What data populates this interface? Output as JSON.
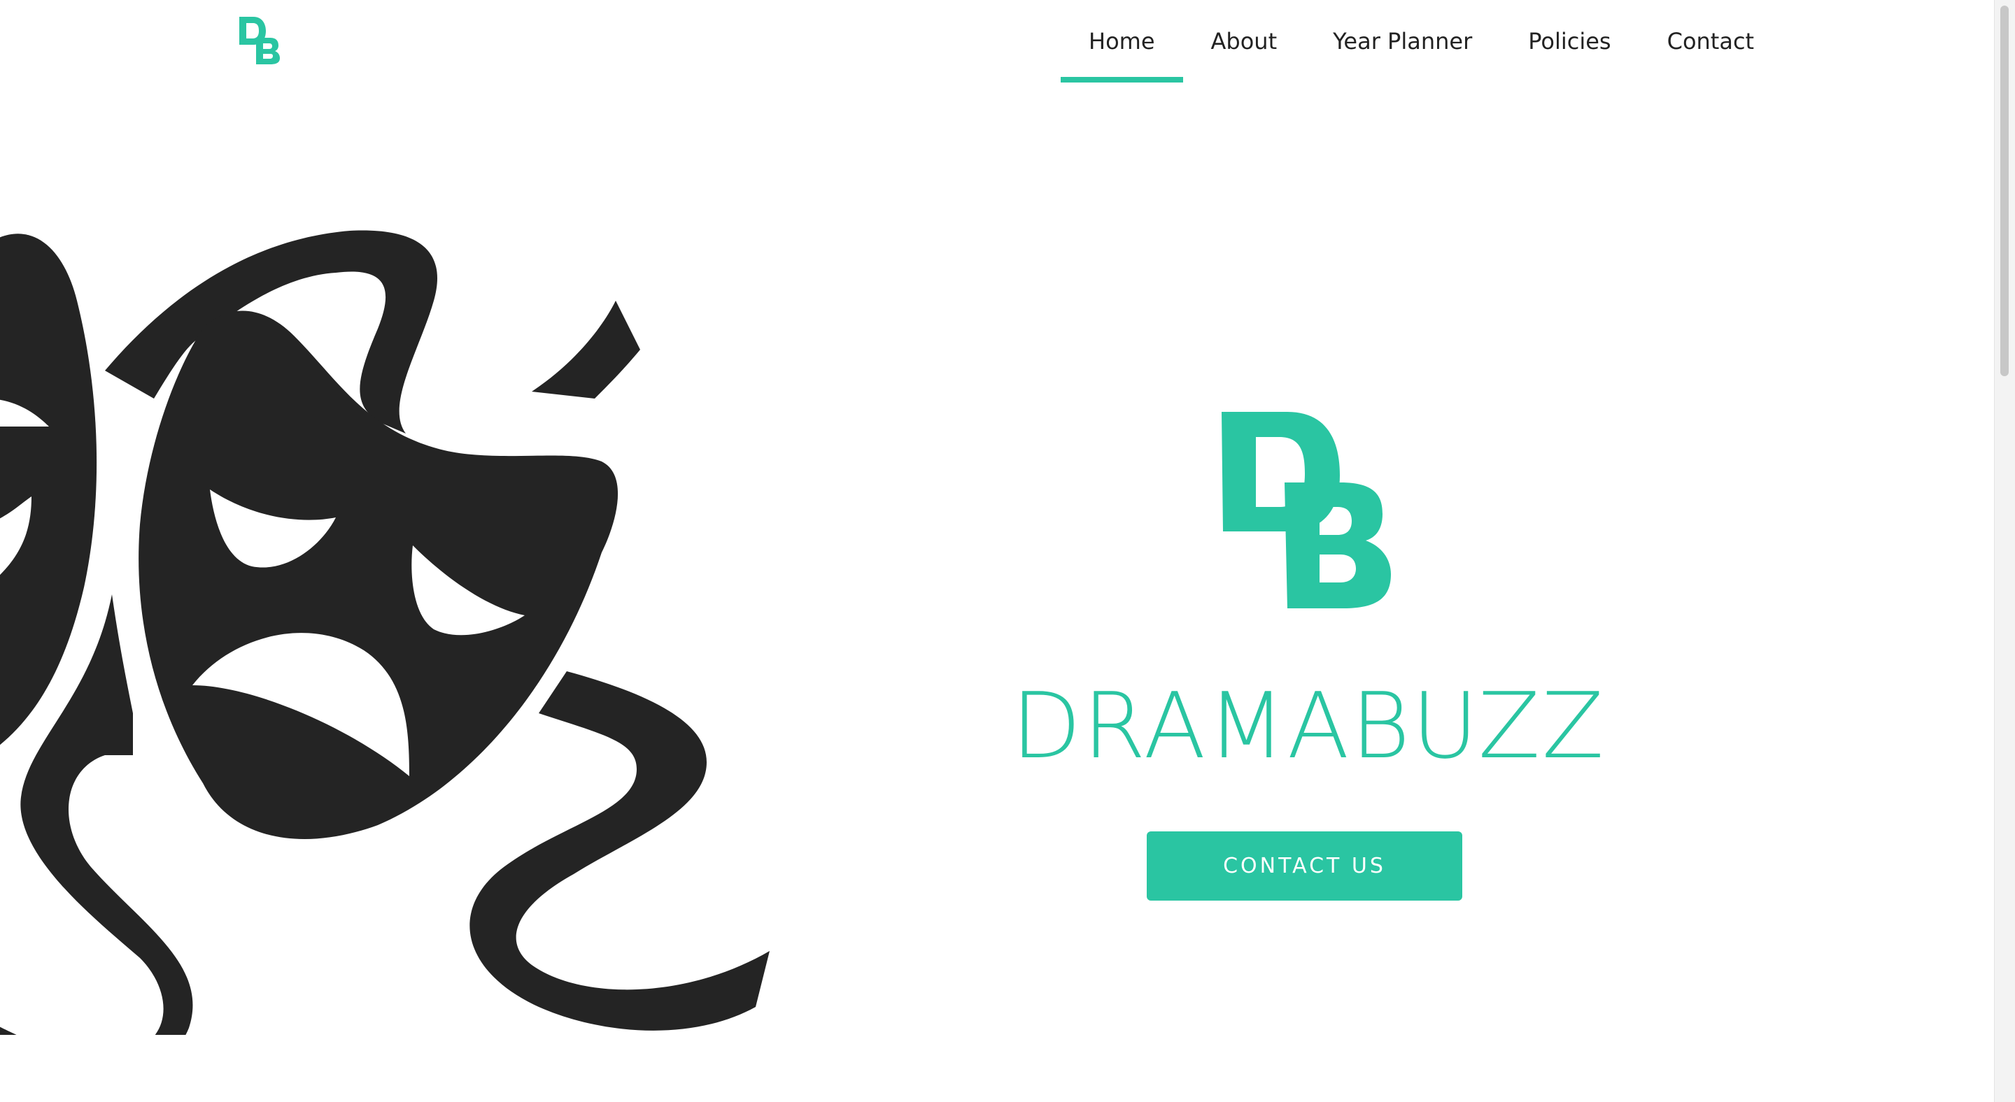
{
  "brand": {
    "logo_letters": "DB",
    "name": "DRAMABUZZ",
    "accent_color": "#2ac5a2"
  },
  "nav": {
    "items": [
      {
        "label": "Home",
        "active": true
      },
      {
        "label": "About"
      },
      {
        "label": "Year Planner"
      },
      {
        "label": "Policies"
      },
      {
        "label": "Contact"
      }
    ]
  },
  "hero": {
    "illustration": "theatre-masks-icon",
    "cta_label": "CONTACT US"
  },
  "colors": {
    "text": "#222222",
    "mask": "#242424",
    "background": "#ffffff"
  }
}
